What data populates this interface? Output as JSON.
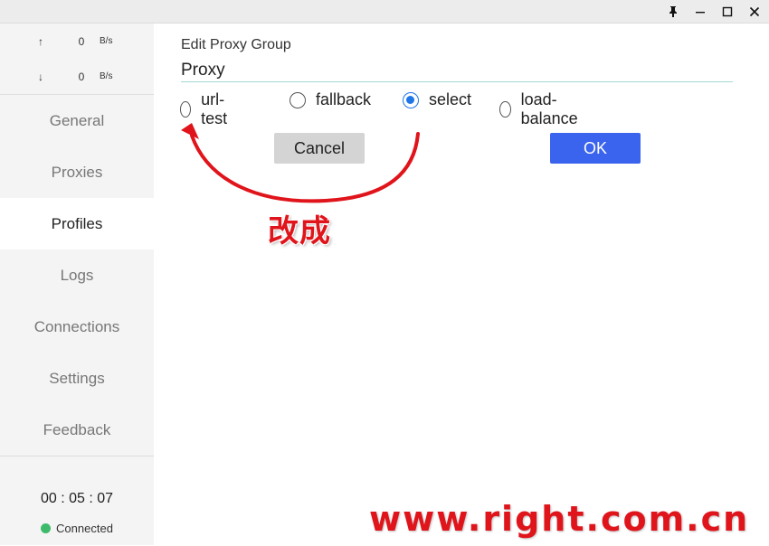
{
  "titlebar": {
    "buttons": [
      {
        "name": "pin",
        "glyph": "📌"
      },
      {
        "name": "minimize",
        "glyph": "—"
      },
      {
        "name": "maximize",
        "glyph": "☐"
      },
      {
        "name": "close",
        "glyph": "✕"
      }
    ]
  },
  "sidebar": {
    "traffic": {
      "up": {
        "arrow": "↑",
        "value": "0",
        "unit": "B/s"
      },
      "down": {
        "arrow": "↓",
        "value": "0",
        "unit": "B/s"
      }
    },
    "items": [
      {
        "label": "General"
      },
      {
        "label": "Proxies"
      },
      {
        "label": "Profiles"
      },
      {
        "label": "Logs"
      },
      {
        "label": "Connections"
      },
      {
        "label": "Settings"
      },
      {
        "label": "Feedback"
      }
    ],
    "active_index": 2,
    "clock": "00 : 05 : 07",
    "status": "Connected",
    "status_color": "#3dbb6b"
  },
  "dialog": {
    "title": "Edit Proxy Group",
    "name_value": "Proxy",
    "types": [
      {
        "label": "url-test",
        "checked": false
      },
      {
        "label": "fallback",
        "checked": false
      },
      {
        "label": "select",
        "checked": true
      },
      {
        "label": "load-balance",
        "checked": false
      }
    ],
    "cancel_label": "Cancel",
    "ok_label": "OK",
    "accent": "#3a63ee"
  },
  "annotation": {
    "text": "改成",
    "color": "#e0141b"
  },
  "watermark": "www.right.com.cn"
}
